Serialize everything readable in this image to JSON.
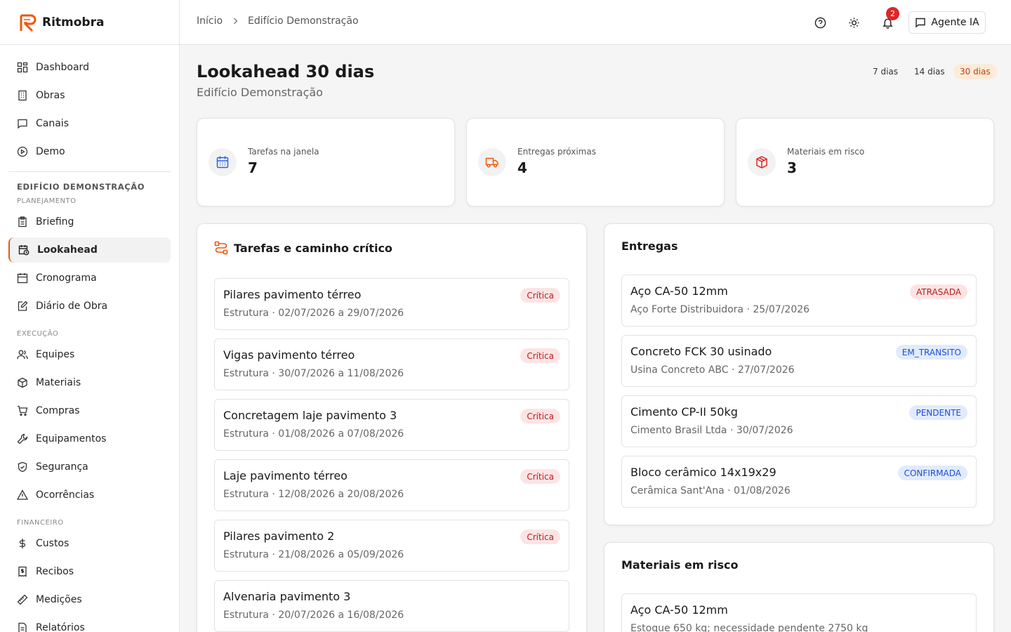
{
  "brand": {
    "name": "Ritmobra",
    "accent": "#ea580c"
  },
  "sidebar": {
    "top": [
      {
        "label": "Dashboard",
        "icon": "dashboard-icon"
      },
      {
        "label": "Obras",
        "icon": "building-icon"
      },
      {
        "label": "Canais",
        "icon": "chat-icon"
      },
      {
        "label": "Demo",
        "icon": "play-icon"
      }
    ],
    "project": "EDIFÍCIO DEMONSTRAÇÃO",
    "groups": {
      "planejamento": "PLANEJAMENTO",
      "execucao": "EXECUÇÃO",
      "financeiro": "FINANCEIRO"
    },
    "planejamento": [
      {
        "label": "Briefing"
      },
      {
        "label": "Lookahead"
      },
      {
        "label": "Cronograma"
      },
      {
        "label": "Diário de Obra"
      }
    ],
    "execucao": [
      {
        "label": "Equipes"
      },
      {
        "label": "Materiais"
      },
      {
        "label": "Compras"
      },
      {
        "label": "Equipamentos"
      },
      {
        "label": "Segurança"
      },
      {
        "label": "Ocorrências"
      }
    ],
    "financeiro": [
      {
        "label": "Custos"
      },
      {
        "label": "Recibos"
      },
      {
        "label": "Medições"
      },
      {
        "label": "Relatórios"
      }
    ]
  },
  "topbar": {
    "breadcrumb": [
      "Início",
      "Edifício Demonstração"
    ],
    "notifications": "2",
    "agent_label": "Agente IA"
  },
  "page": {
    "title": "Lookahead 30 dias",
    "subtitle": "Edifício Demonstração",
    "ranges": [
      "7 dias",
      "14 dias",
      "30 dias"
    ]
  },
  "stats": [
    {
      "label": "Tarefas na janela",
      "value": "7",
      "icon": "calendar-icon",
      "color": "#2563eb"
    },
    {
      "label": "Entregas próximas",
      "value": "4",
      "icon": "truck-icon",
      "color": "#ea580c"
    },
    {
      "label": "Materiais em risco",
      "value": "3",
      "icon": "box-icon",
      "color": "#dc2626"
    }
  ],
  "tasks": {
    "title": "Tarefas e caminho crítico",
    "items": [
      {
        "title": "Pilares pavimento térreo",
        "sub": "Estrutura · 02/07/2026 a 29/07/2026",
        "tag": "Crítica"
      },
      {
        "title": "Vigas pavimento térreo",
        "sub": "Estrutura · 30/07/2026 a 11/08/2026",
        "tag": "Crítica"
      },
      {
        "title": "Concretagem laje pavimento 3",
        "sub": "Estrutura · 01/08/2026 a 07/08/2026",
        "tag": "Crítica"
      },
      {
        "title": "Laje pavimento térreo",
        "sub": "Estrutura · 12/08/2026 a 20/08/2026",
        "tag": "Crítica"
      },
      {
        "title": "Pilares pavimento 2",
        "sub": "Estrutura · 21/08/2026 a 05/09/2026",
        "tag": "Crítica"
      },
      {
        "title": "Alvenaria pavimento 3",
        "sub": "Estrutura · 20/07/2026 a 16/08/2026",
        "tag": ""
      }
    ]
  },
  "deliveries": {
    "title": "Entregas",
    "items": [
      {
        "title": "Aço CA-50 12mm",
        "sub": "Aço Forte Distribuidora · 25/07/2026",
        "tag": "ATRASADA",
        "tone": "red"
      },
      {
        "title": "Concreto FCK 30 usinado",
        "sub": "Usina Concreto ABC · 27/07/2026",
        "tag": "EM_TRANSITO",
        "tone": "blue"
      },
      {
        "title": "Cimento CP-II 50kg",
        "sub": "Cimento Brasil Ltda · 30/07/2026",
        "tag": "PENDENTE",
        "tone": "blue"
      },
      {
        "title": "Bloco cerâmico 14x19x29",
        "sub": "Cerâmica Sant'Ana · 01/08/2026",
        "tag": "CONFIRMADA",
        "tone": "blue"
      }
    ]
  },
  "risk": {
    "title": "Materiais em risco",
    "items": [
      {
        "title": "Aço CA-50 12mm",
        "sub": "Estoque 650 kg; necessidade pendente 2750 kg"
      }
    ]
  }
}
